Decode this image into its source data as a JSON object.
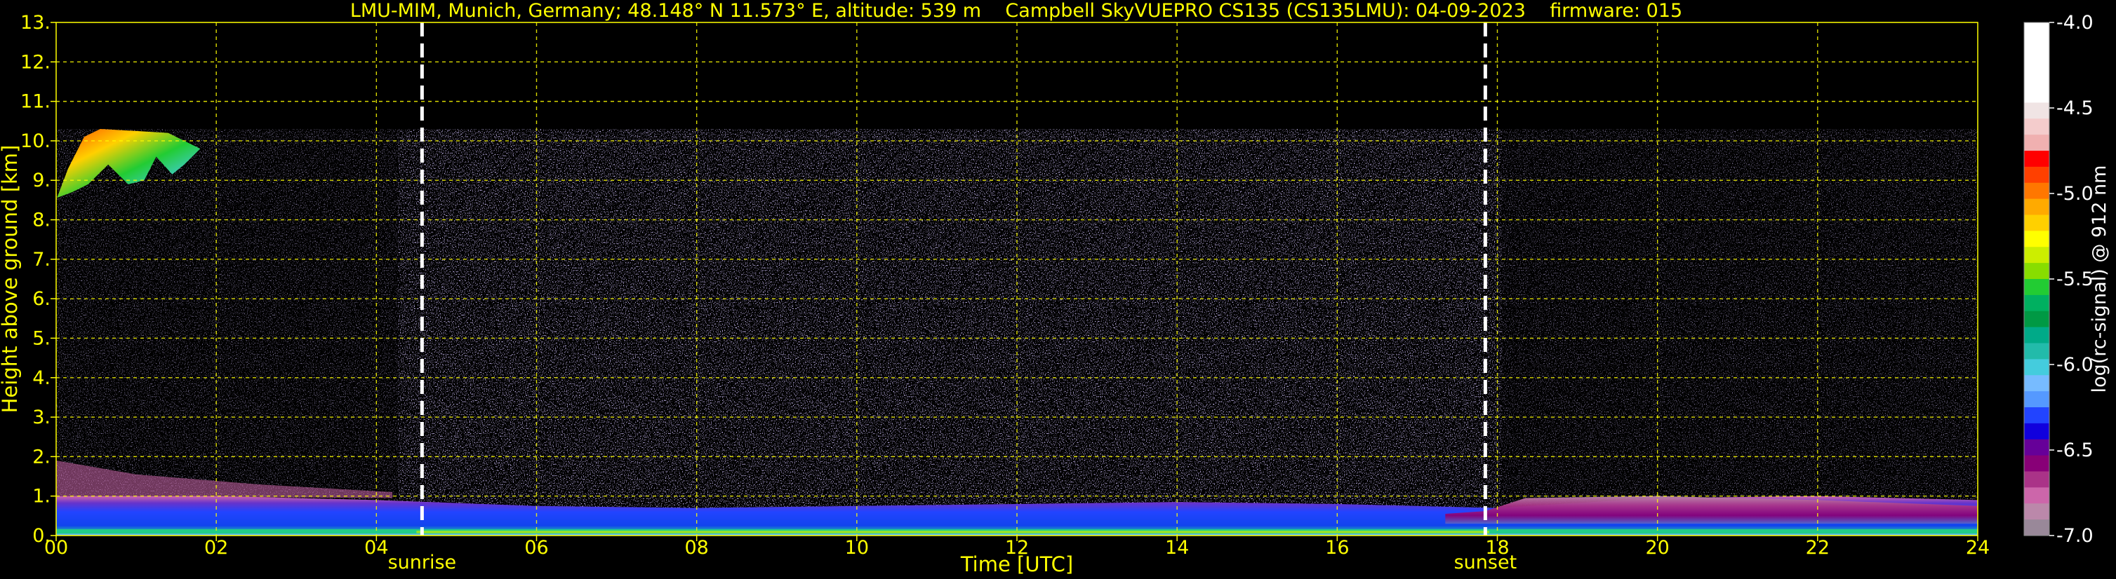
{
  "chart_data": {
    "type": "heatmap",
    "title": "LMU-MIM, Munich, Germany; 48.148° N 11.573° E, altitude: 539 m    Campbell SkyVUEPRO CS135 (CS135LMU): 04-09-2023    firmware: 015",
    "xlabel": "Time [UTC]",
    "ylabel": "Height above ground [km]",
    "xlim": [
      0,
      24
    ],
    "ylim": [
      0,
      13
    ],
    "x_ticks": [
      "00",
      "02",
      "04",
      "06",
      "08",
      "10",
      "12",
      "14",
      "16",
      "18",
      "20",
      "22",
      "24"
    ],
    "y_ticks": [
      "0.",
      "1.",
      "2.",
      "3.",
      "4.",
      "5.",
      "6.",
      "7.",
      "8.",
      "9.",
      "10.",
      "11.",
      "12.",
      "13."
    ],
    "grid": true,
    "events": [
      {
        "label": "sunrise",
        "time": 4.57
      },
      {
        "label": "sunset",
        "time": 17.85
      }
    ],
    "features": [
      {
        "name": "boundary-layer",
        "x": [
          0,
          24
        ],
        "y_top_km": [
          1.0,
          1.0,
          0.9,
          0.75,
          0.7,
          0.75,
          0.8,
          0.85,
          0.8,
          0.7,
          0.95,
          1.0,
          0.9
        ]
      },
      {
        "name": "cirrus",
        "x": [
          0,
          1.8
        ],
        "y_km": [
          8.5,
          10.3
        ]
      },
      {
        "name": "background-noise",
        "x": [
          0,
          24
        ],
        "y_km": [
          0,
          10.3
        ]
      }
    ],
    "colorbar": {
      "label": "log(rc-signal) @ 912 nm",
      "range": [
        -7.0,
        -4.0
      ],
      "ticks": [
        "-4.0",
        "-4.5",
        "-5.0",
        "-5.5",
        "-6.0",
        "-6.5",
        "-7.0"
      ],
      "colors": [
        "#ffffff",
        "#ffffff",
        "#ffffff",
        "#ffffff",
        "#ffffff",
        "#f0e4e4",
        "#f4cccc",
        "#f0b0b0",
        "#ff0000",
        "#ff4000",
        "#ff7700",
        "#ffaa00",
        "#ffd000",
        "#ffff00",
        "#ccee00",
        "#88dd00",
        "#22cc33",
        "#00b060",
        "#009944",
        "#00aa88",
        "#22bbaa",
        "#44ccdd",
        "#77bbff",
        "#5599ff",
        "#2244ff",
        "#1100dd",
        "#660099",
        "#880077",
        "#aa3388",
        "#cc66aa",
        "#bb88aa",
        "#998899"
      ]
    }
  }
}
